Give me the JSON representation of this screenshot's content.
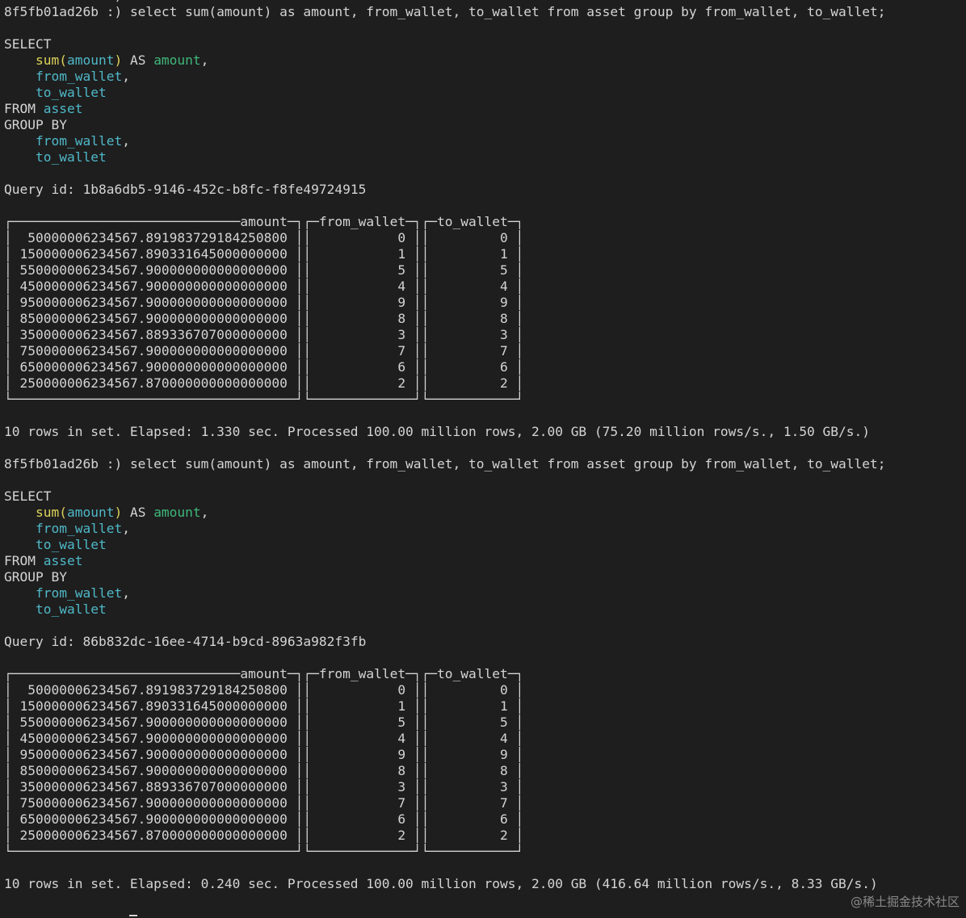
{
  "prompt": "8f5fb01ad26b :)",
  "watermark": "@稀土掘金技术社区",
  "blocks": [
    {
      "command": "select sum(amount) as amount, from_wallet, to_wallet from asset group by from_wallet, to_wallet;",
      "query_id_label": "Query id:",
      "query_id": "1b8a6db5-9146-452c-b8fc-f8fe49724915",
      "columns": [
        "amount",
        "from_wallet",
        "to_wallet"
      ],
      "rows": [
        [
          "50000006234567.891983729184250800",
          "0",
          "0"
        ],
        [
          "150000006234567.890331645000000000",
          "1",
          "1"
        ],
        [
          "550000006234567.900000000000000000",
          "5",
          "5"
        ],
        [
          "450000006234567.900000000000000000",
          "4",
          "4"
        ],
        [
          "950000006234567.900000000000000000",
          "9",
          "9"
        ],
        [
          "850000006234567.900000000000000000",
          "8",
          "8"
        ],
        [
          "350000006234567.889336707000000000",
          "3",
          "3"
        ],
        [
          "750000006234567.900000000000000000",
          "7",
          "7"
        ],
        [
          "650000006234567.900000000000000000",
          "6",
          "6"
        ],
        [
          "250000006234567.870000000000000000",
          "2",
          "2"
        ]
      ],
      "footer": "10 rows in set. Elapsed: 1.330 sec. Processed 100.00 million rows, 2.00 GB (75.20 million rows/s., 1.50 GB/s.)"
    },
    {
      "command": "select sum(amount) as amount, from_wallet, to_wallet from asset group by from_wallet, to_wallet;",
      "query_id_label": "Query id:",
      "query_id": "86b832dc-16ee-4714-b9cd-8963a982f3fb",
      "columns": [
        "amount",
        "from_wallet",
        "to_wallet"
      ],
      "rows": [
        [
          "50000006234567.891983729184250800",
          "0",
          "0"
        ],
        [
          "150000006234567.890331645000000000",
          "1",
          "1"
        ],
        [
          "550000006234567.900000000000000000",
          "5",
          "5"
        ],
        [
          "450000006234567.900000000000000000",
          "4",
          "4"
        ],
        [
          "950000006234567.900000000000000000",
          "9",
          "9"
        ],
        [
          "850000006234567.900000000000000000",
          "8",
          "8"
        ],
        [
          "350000006234567.889336707000000000",
          "3",
          "3"
        ],
        [
          "750000006234567.900000000000000000",
          "7",
          "7"
        ],
        [
          "650000006234567.900000000000000000",
          "6",
          "6"
        ],
        [
          "250000006234567.870000000000000000",
          "2",
          "2"
        ]
      ],
      "footer": "10 rows in set. Elapsed: 0.240 sec. Processed 100.00 million rows, 2.00 GB (416.64 million rows/s., 8.33 GB/s.)"
    }
  ]
}
